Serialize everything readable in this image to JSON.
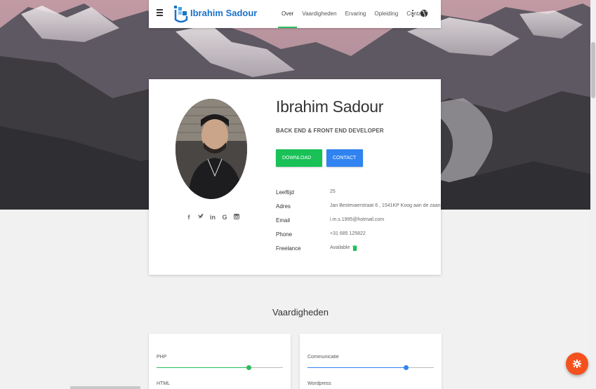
{
  "navbar": {
    "brand": "Ibrahim Sadour",
    "links": [
      "Over",
      "Vaardigheden",
      "Ervaring",
      "Opleiding",
      "Contact"
    ],
    "active_link": "Over",
    "icons": [
      "menu-icon",
      "logo-icon",
      "more-vert-icon",
      "globe-icon"
    ]
  },
  "profile": {
    "name": "Ibrahim Sadour",
    "role": "BACK END & FRONT END DEVELOPER",
    "download_label": "DOWNLOAD CV ⬇",
    "contact_label": "CONTACT ⊙",
    "socials": [
      "f",
      "🐦",
      "in",
      "G",
      "◙"
    ],
    "info": [
      {
        "label": "Leeftijd",
        "value": "25"
      },
      {
        "label": "Adres",
        "value": "Jan Bestevaerstraat 6 , 1541KP Koog aan de zaan"
      },
      {
        "label": "Email",
        "value": "i.m.s.1995@hotmail.com"
      },
      {
        "label": "Phone",
        "value": "+31 685 125822"
      },
      {
        "label": "Freelance",
        "value": "Available"
      }
    ]
  },
  "skills": {
    "title": "Vaardigheden",
    "left": [
      {
        "name": "PHP",
        "level": 0.73,
        "color": "#2bbd5b"
      },
      {
        "name": "HTML",
        "level": 0.0,
        "color": "#2bbd5b"
      }
    ],
    "right": [
      {
        "name": "Communicatie",
        "level": 0.78,
        "color": "#3083f0"
      },
      {
        "name": "Wordpress",
        "level": 0.0,
        "color": "#3083f0"
      }
    ]
  },
  "fab": {
    "icon": "settings-icon",
    "color": "#f4511e"
  }
}
